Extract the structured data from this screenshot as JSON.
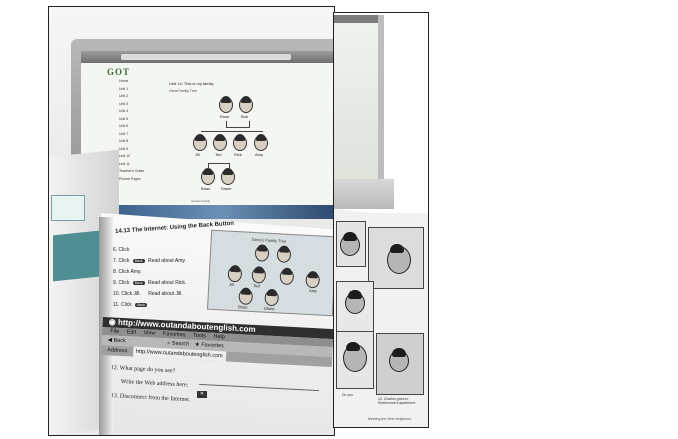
{
  "laptop_screen": {
    "site_logo": "GOT",
    "unit_title": "Unit 14: This is my family.",
    "subtitle": "Gena Family Tree",
    "menu_items": [
      "Home",
      "Unit 1",
      "Unit 2",
      "Unit 3",
      "Unit 4",
      "Unit 5",
      "Unit 6",
      "Unit 7",
      "Unit 8",
      "Unit 9",
      "Unit 10",
      "Unit 11",
      "Teacher's Guide",
      "Picture Pages"
    ],
    "people": [
      "Rose",
      "Bob",
      "Jill",
      "Ted",
      "Rick",
      "Amy",
      "Brian",
      "Diane"
    ],
    "footer": "Gena's Family"
  },
  "textbook": {
    "section_title": "14.13 The Internet: Using the Back Button",
    "steps": [
      "6. Click",
      "7. Click",
      "8. Click Amy.",
      "9. Click",
      "10. Click Jill.",
      "11. Click"
    ],
    "step_readers": [
      "Read about Amy.",
      "Read about Rick.",
      "Read about Jill."
    ],
    "back_label": "Back",
    "tree_caption": "Gena's Family Tree",
    "tree_people": [
      "Rose",
      "Bob",
      "Jill",
      "Ted",
      "Rick",
      "Amy",
      "Brian",
      "Diane"
    ],
    "url_bar": "http://www.outandaboutenglish.com",
    "menu_bar": [
      "File",
      "Edit",
      "View",
      "Favorites",
      "Tools",
      "Help"
    ],
    "toolbar": {
      "back": "Back",
      "search": "Search",
      "favorites": "Favorites"
    },
    "address_label": "Address",
    "address_value": "http://www.outandaboutenglish.com",
    "questions": [
      "12. What page do you see?",
      "Write the Web address here:",
      "13. Disconnect from the Internet."
    ]
  },
  "side_page": {
    "captions": [
      "Do you",
      "12. Charles goes to Shelbourne's apartment."
    ],
    "footer": "Meeting the New Neighbors"
  }
}
